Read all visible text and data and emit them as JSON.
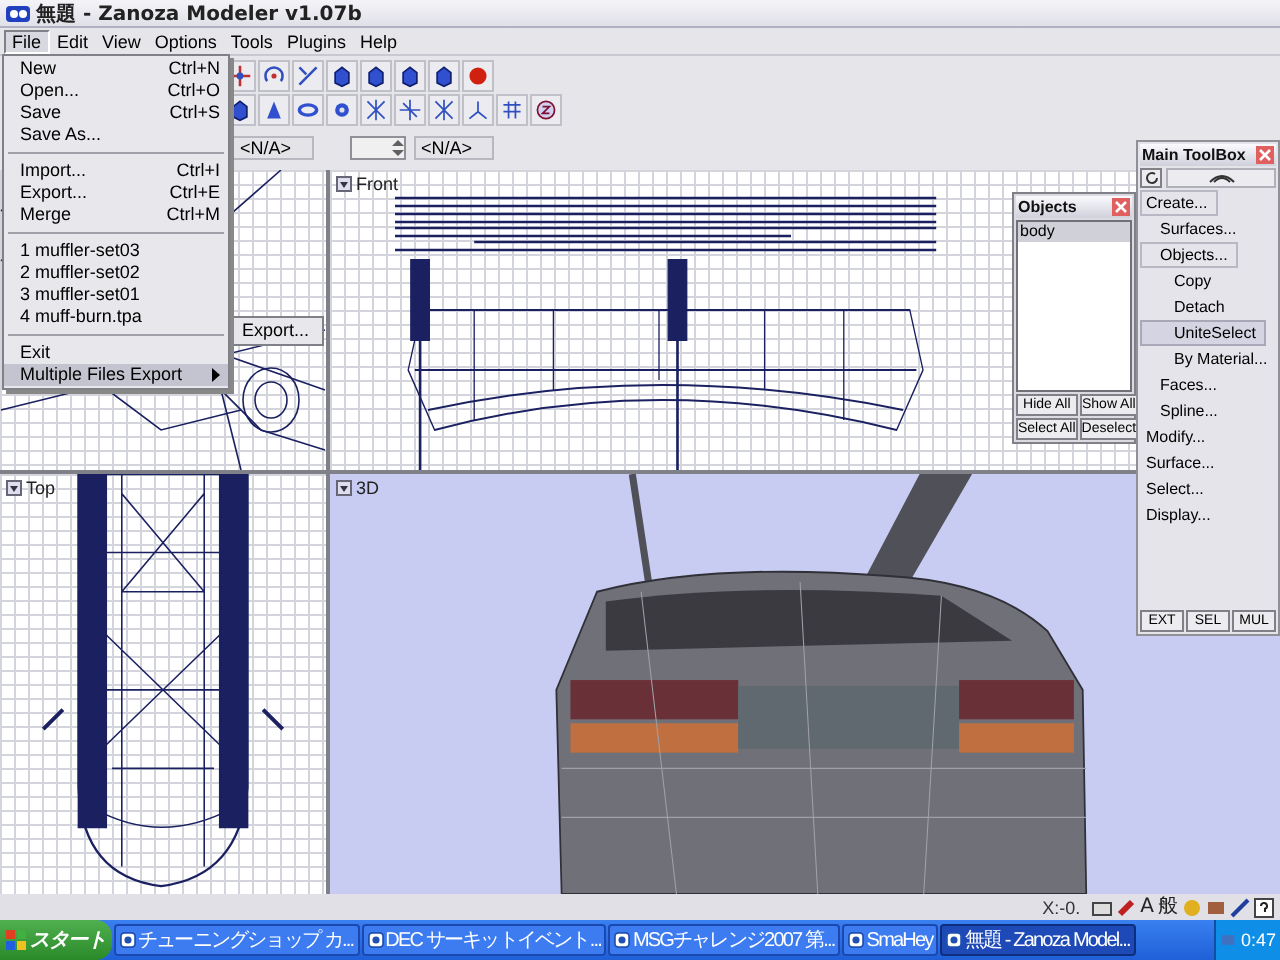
{
  "window": {
    "title": "無題 - Zanoza Modeler v1.07b"
  },
  "menu_bar": [
    {
      "label": "File",
      "selected": true
    },
    {
      "label": "Edit",
      "selected": false
    },
    {
      "label": "View",
      "selected": false
    },
    {
      "label": "Options",
      "selected": false
    },
    {
      "label": "Tools",
      "selected": false
    },
    {
      "label": "Plugins",
      "selected": false
    },
    {
      "label": "Help",
      "selected": false
    }
  ],
  "file_menu": [
    {
      "kind": "item",
      "label": "New",
      "shortcut": "Ctrl+N",
      "selected": false
    },
    {
      "kind": "item",
      "label": "Open...",
      "shortcut": "Ctrl+O",
      "selected": false
    },
    {
      "kind": "item",
      "label": "Save",
      "shortcut": "Ctrl+S",
      "selected": false
    },
    {
      "kind": "item",
      "label": "Save As...",
      "selected": false
    },
    {
      "kind": "separator"
    },
    {
      "kind": "item",
      "label": "Import...",
      "shortcut": "Ctrl+I",
      "selected": false
    },
    {
      "kind": "item",
      "label": "Export...",
      "shortcut": "Ctrl+E",
      "selected": false
    },
    {
      "kind": "item",
      "label": "Merge",
      "shortcut": "Ctrl+M",
      "selected": false
    },
    {
      "kind": "separator"
    },
    {
      "kind": "item",
      "label": "1 muffler-set03",
      "selected": false
    },
    {
      "kind": "item",
      "label": "2 muffler-set02",
      "selected": false
    },
    {
      "kind": "item",
      "label": "3 muffler-set01",
      "selected": false
    },
    {
      "kind": "item",
      "label": "4 muff-burn.tpa",
      "selected": false
    },
    {
      "kind": "separator"
    },
    {
      "kind": "item",
      "label": "Exit",
      "selected": false
    },
    {
      "kind": "submenu",
      "label": "Multiple Files Export",
      "selected": true,
      "children": [
        {
          "label": "Export..."
        }
      ]
    }
  ],
  "fields": [
    {
      "kind": "text",
      "value": "<N/A>"
    },
    {
      "kind": "spin",
      "value": "<N/A>"
    }
  ],
  "viewports": [
    {
      "kind": "side"
    },
    {
      "kind": "front",
      "label": "Front"
    },
    {
      "kind": "top",
      "label": "Top"
    },
    {
      "kind": "render",
      "label": "3D"
    }
  ],
  "objects_panel": {
    "title": "Objects",
    "items": [
      {
        "label": "body",
        "selected": true
      }
    ],
    "buttons": [
      "Hide All",
      "Show All",
      "Select All",
      "Deselect"
    ]
  },
  "toolbox": {
    "title": "Main ToolBox",
    "items": [
      {
        "label": "Create...",
        "selected": false,
        "expanded": true,
        "children": [
          {
            "label": "Surfaces...",
            "selected": false
          },
          {
            "label": "Objects...",
            "selected": false,
            "expanded": true,
            "children": [
              {
                "label": "Copy",
                "selected": false
              },
              {
                "label": "Detach",
                "selected": false
              },
              {
                "label": "UniteSelect",
                "selected": true
              },
              {
                "label": "By Material...",
                "selected": false
              }
            ]
          },
          {
            "label": "Faces...",
            "selected": false
          },
          {
            "label": "Spline...",
            "selected": false
          }
        ]
      },
      {
        "label": "Modify...",
        "selected": false
      },
      {
        "label": "Surface...",
        "selected": false
      },
      {
        "label": "Select...",
        "selected": false
      },
      {
        "label": "Display...",
        "selected": false
      }
    ],
    "buttons": [
      "EXT",
      "SEL",
      "MUL"
    ]
  },
  "status_bar": {
    "text": "X:-0.",
    "ime_mode": "A",
    "ime_dictionary": "般"
  },
  "taskbar": {
    "start": "スタート",
    "tasks": [
      {
        "label": "チューニングショップ カ...",
        "selected": false
      },
      {
        "label": "DEC サーキットイベント...",
        "selected": false
      },
      {
        "label": "MSGチャレンジ2007 第...",
        "selected": false
      },
      {
        "label": "SmaHey",
        "selected": false
      },
      {
        "label": "無題 - Zanoza Model...",
        "selected": true
      }
    ],
    "clock": "0:47"
  }
}
